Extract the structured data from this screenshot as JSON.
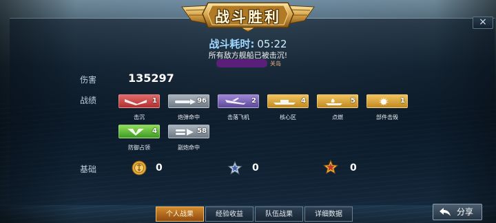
{
  "header": {
    "title": "战斗胜利",
    "close_label": "×"
  },
  "summary": {
    "time_label": "战斗耗时:",
    "time_value": "05:22",
    "message": "所有敌方舰船已被击沉!",
    "note_suffix": "关岛"
  },
  "damage": {
    "label": "伤害",
    "value": "135297"
  },
  "record": {
    "label": "战绩",
    "medals": [
      {
        "caption": "击沉",
        "count": "1",
        "color": "red",
        "icon": "ship-sink-icon"
      },
      {
        "caption": "炮弹命中",
        "count": "96",
        "color": "grey",
        "icon": "shell-hit-icon"
      },
      {
        "caption": "击落飞机",
        "count": "2",
        "color": "purple",
        "icon": "plane-down-icon"
      },
      {
        "caption": "核心区",
        "count": "4",
        "color": "gold",
        "icon": "core-zone-icon"
      },
      {
        "caption": "点燃",
        "count": "5",
        "color": "gold",
        "icon": "ignite-icon"
      },
      {
        "caption": "部件击毁",
        "count": "1",
        "color": "gold",
        "icon": "part-destroy-icon"
      },
      {
        "caption": "防御占领",
        "count": "4",
        "color": "green",
        "icon": "defend-capture-icon"
      },
      {
        "caption": "副炮命中",
        "count": "58",
        "color": "grey",
        "icon": "secondary-hit-icon"
      }
    ]
  },
  "base": {
    "label": "基础",
    "resources": [
      {
        "icon": "gold-coin-icon",
        "value": "0"
      },
      {
        "icon": "silver-star-icon",
        "value": "0"
      },
      {
        "icon": "gold-star-icon",
        "value": "0"
      }
    ]
  },
  "tabs": [
    {
      "label": "个人战果",
      "active": true
    },
    {
      "label": "经验收益",
      "active": false
    },
    {
      "label": "队伍战果",
      "active": false
    },
    {
      "label": "详细数据",
      "active": false
    }
  ],
  "share": {
    "label": "分享"
  },
  "colors": {
    "accent_gold": "#d48b2e",
    "time_blue": "#9fd8ff",
    "label_blue": "#b9cfe0"
  }
}
